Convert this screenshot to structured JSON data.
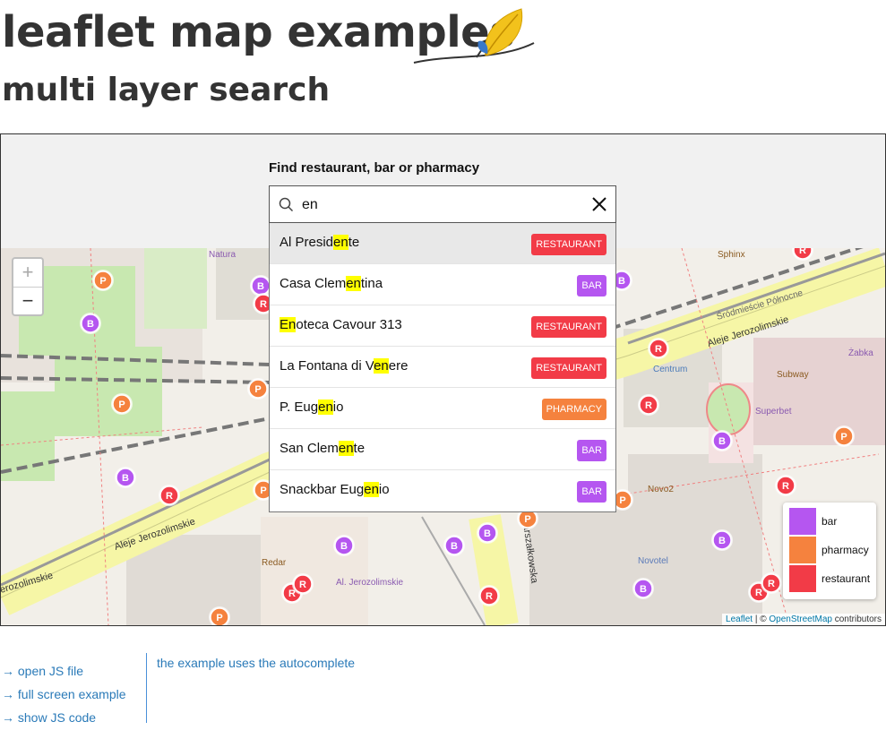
{
  "header": {
    "title": "leaflet map examples",
    "subtitle": "multi layer search"
  },
  "search": {
    "label": "Find restaurant, bar or pharmacy",
    "value": "en",
    "results": [
      {
        "pre": "Al Presid",
        "match": "en",
        "post": "te",
        "category": "RESTAURANT"
      },
      {
        "pre": "Casa Clem",
        "match": "en",
        "post": "tina",
        "category": "BAR"
      },
      {
        "pre": "",
        "match": "En",
        "post": "oteca Cavour 313",
        "category": "RESTAURANT"
      },
      {
        "pre": "La Fontana di V",
        "match": "en",
        "post": "ere",
        "category": "RESTAURANT"
      },
      {
        "pre": "P. Eug",
        "match": "en",
        "post": "io",
        "category": "PHARMACY"
      },
      {
        "pre": "San Clem",
        "match": "en",
        "post": "te",
        "category": "BAR"
      },
      {
        "pre": "Snackbar Eug",
        "match": "en",
        "post": "io",
        "category": "BAR"
      }
    ]
  },
  "colors": {
    "restaurant": "#f23b47",
    "bar": "#b556f0",
    "pharmacy": "#f5823e"
  },
  "map": {
    "zoom_in": "+",
    "zoom_out": "−",
    "legend": [
      {
        "label": "bar",
        "color": "#b556f0"
      },
      {
        "label": "pharmacy",
        "color": "#f5823e"
      },
      {
        "label": "restaurant",
        "color": "#f23b47"
      }
    ],
    "attribution": {
      "leaflet": "Leaflet",
      "sep": " | © ",
      "osm": "OpenStreetMap",
      "rest": " contributors"
    },
    "street_labels": {
      "aleje_1": "Aleje Jerozolimskie",
      "aleje_2": "Aleje Jerozolimskie",
      "aleje_3": "erozolimskie",
      "srodmiescie": "Śródmieście Północne",
      "marszalkowska": "Marszałkowska",
      "al_jerozolimskie": "Al. Jerozolimskie",
      "centrum": "Centrum",
      "novotel": "Novotel",
      "novo2": "Novo2",
      "subway": "Subway",
      "superbet": "Superbet",
      "zabka": "Żabka",
      "sphinx": "Sphinx",
      "redar": "Redar",
      "natura": "Natura"
    },
    "marker_letters": {
      "bar": "B",
      "pharmacy": "P",
      "restaurant": "R"
    }
  },
  "footer": {
    "links": [
      "→ open JS file",
      "→ full screen example",
      "→ show JS code"
    ],
    "note": "the example uses the autocomplete"
  }
}
